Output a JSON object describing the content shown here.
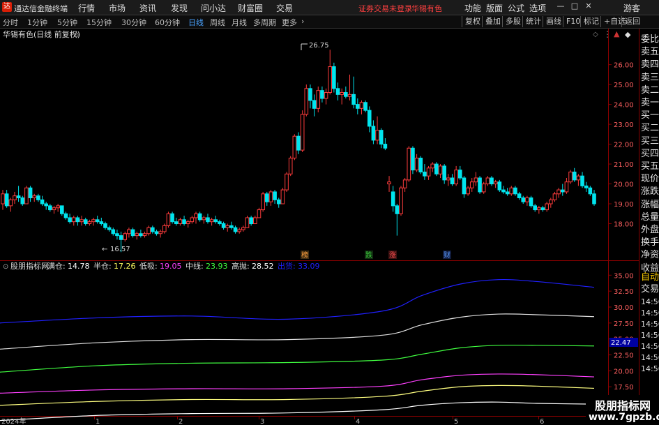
{
  "app": {
    "title": "通达信金融终端",
    "logo_text": "达"
  },
  "menu": [
    "行情",
    "市场",
    "资讯",
    "发现",
    "问小达",
    "财富圈",
    "交易"
  ],
  "warning": {
    "status": "证券交易未登录",
    "stock": "华锡有色"
  },
  "top_right": [
    "功能",
    "版面",
    "公式",
    "选项"
  ],
  "window_buttons": {
    "min": "—",
    "max": "□",
    "close": "✕",
    "guest": "游客"
  },
  "periods": [
    "分时",
    "1分钟",
    "5分钟",
    "15分钟",
    "30分钟",
    "60分钟",
    "日线",
    "周线",
    "月线",
    "多周期",
    "更多"
  ],
  "active_period": "日线",
  "toolbar_right": [
    "复权",
    "叠加",
    "多股",
    "统计",
    "画线",
    "F10",
    "标记",
    "+自选",
    "返回"
  ],
  "main_chart": {
    "title": "华锡有色(日线 前复权)",
    "max_label": "26.75",
    "min_label": "16.57"
  },
  "signals": [
    {
      "text": "榜",
      "color": "#ffa040"
    },
    {
      "text": "跌",
      "color": "#3dd13d"
    },
    {
      "text": "涨",
      "color": "#ff5050"
    },
    {
      "text": "财",
      "color": "#5a9bff"
    }
  ],
  "indicator": {
    "name": "股朋指标网",
    "items": [
      {
        "label": "满仓:",
        "value": "14.78",
        "color": "#ffffff"
      },
      {
        "label": "半仓:",
        "value": "17.26",
        "color": "#ffff60"
      },
      {
        "label": "低吸:",
        "value": "19.05",
        "color": "#ff40ff"
      },
      {
        "label": "中线:",
        "value": "23.93",
        "color": "#40ff40"
      },
      {
        "label": "高抛:",
        "value": "28.52",
        "color": "#ffffff"
      },
      {
        "label": "出货:",
        "value": "33.09",
        "color": "#2020ff"
      }
    ],
    "current": "22.47"
  },
  "right_panel": {
    "quote": [
      "委比",
      "卖五",
      "卖四",
      "卖三",
      "卖二",
      "卖一",
      "买一",
      "买二",
      "买三",
      "买四",
      "买五",
      "现价",
      "涨跌",
      "涨幅",
      "总量",
      "外盘",
      "换手",
      "净资",
      "收益"
    ],
    "lower": [
      "自动",
      "交易"
    ],
    "times": [
      "14:56",
      "14:56",
      "14:56",
      "14:56",
      "14:56",
      "14:56",
      "14:56"
    ]
  },
  "x_axis": [
    "2024年",
    "1",
    "2",
    "3",
    "4",
    "5",
    "6"
  ],
  "watermark": {
    "line1": "股朋指标网",
    "line2": "www.7gpzb.com"
  },
  "chart_data": [
    {
      "type": "candlestick",
      "title": "华锡有色(日线 前复权)",
      "ylim": [
        17.0,
        26.9
      ],
      "yticks": [
        18,
        19,
        20,
        21,
        22,
        23,
        24,
        25,
        26
      ],
      "ohlc": [
        [
          19.0,
          19.7,
          18.7,
          19.5
        ],
        [
          19.5,
          19.7,
          18.8,
          18.9
        ],
        [
          18.9,
          19.3,
          18.6,
          19.2
        ],
        [
          19.2,
          19.6,
          19.0,
          19.4
        ],
        [
          19.4,
          19.9,
          19.1,
          19.3
        ],
        [
          19.3,
          19.4,
          18.9,
          19.0
        ],
        [
          19.0,
          19.9,
          19.0,
          19.8
        ],
        [
          19.8,
          19.9,
          19.1,
          19.3
        ],
        [
          19.3,
          19.5,
          19.1,
          19.4
        ],
        [
          19.4,
          19.5,
          19.1,
          19.2
        ],
        [
          19.2,
          19.4,
          18.9,
          19.0
        ],
        [
          19.0,
          19.1,
          18.7,
          18.9
        ],
        [
          18.9,
          19.0,
          18.6,
          18.7
        ],
        [
          18.7,
          18.9,
          18.5,
          18.8
        ],
        [
          18.8,
          19.0,
          18.6,
          18.9
        ],
        [
          18.9,
          18.9,
          18.4,
          18.5
        ],
        [
          18.5,
          18.6,
          18.2,
          18.3
        ],
        [
          18.3,
          18.5,
          18.0,
          18.1
        ],
        [
          18.1,
          18.4,
          17.9,
          18.3
        ],
        [
          18.3,
          18.4,
          17.9,
          18.1
        ],
        [
          18.1,
          18.4,
          17.9,
          18.2
        ],
        [
          18.2,
          18.3,
          17.9,
          18.0
        ],
        [
          18.0,
          18.2,
          17.9,
          18.1
        ],
        [
          18.1,
          18.3,
          17.9,
          18.2
        ],
        [
          18.2,
          18.4,
          18.0,
          18.1
        ],
        [
          18.1,
          18.3,
          17.9,
          18.0
        ],
        [
          18.0,
          18.1,
          17.7,
          17.8
        ],
        [
          17.8,
          17.9,
          17.6,
          17.7
        ],
        [
          17.7,
          17.8,
          17.4,
          17.5
        ],
        [
          17.5,
          17.7,
          17.2,
          17.4
        ],
        [
          17.4,
          17.6,
          16.57,
          17.2
        ],
        [
          17.2,
          17.6,
          17.1,
          17.5
        ],
        [
          17.5,
          17.8,
          17.3,
          17.7
        ],
        [
          17.7,
          17.8,
          17.3,
          17.4
        ],
        [
          17.4,
          17.6,
          17.2,
          17.5
        ],
        [
          17.5,
          17.7,
          17.3,
          17.4
        ],
        [
          17.4,
          17.6,
          17.3,
          17.5
        ],
        [
          17.5,
          17.9,
          17.4,
          17.8
        ],
        [
          17.8,
          17.9,
          17.5,
          17.6
        ],
        [
          17.6,
          17.7,
          17.4,
          17.5
        ],
        [
          17.5,
          17.7,
          17.3,
          17.6
        ],
        [
          17.6,
          18.0,
          17.5,
          17.9
        ],
        [
          17.9,
          18.6,
          17.8,
          18.5
        ],
        [
          18.5,
          18.6,
          18.0,
          18.1
        ],
        [
          18.1,
          18.3,
          17.9,
          18.0
        ],
        [
          18.0,
          18.3,
          17.9,
          18.2
        ],
        [
          18.2,
          18.4,
          17.9,
          18.0
        ],
        [
          18.0,
          18.2,
          17.8,
          18.1
        ],
        [
          18.1,
          18.4,
          18.0,
          18.3
        ],
        [
          18.3,
          18.6,
          18.0,
          18.5
        ],
        [
          18.5,
          18.6,
          18.1,
          18.2
        ],
        [
          18.2,
          18.4,
          18.0,
          18.3
        ],
        [
          18.3,
          18.5,
          18.0,
          18.1
        ],
        [
          18.1,
          18.3,
          17.9,
          18.2
        ],
        [
          18.2,
          18.4,
          18.0,
          18.1
        ],
        [
          18.1,
          18.2,
          17.9,
          18.0
        ],
        [
          18.0,
          18.1,
          17.7,
          17.8
        ],
        [
          17.8,
          18.0,
          17.6,
          17.9
        ],
        [
          17.9,
          18.1,
          17.7,
          17.8
        ],
        [
          17.8,
          17.9,
          17.5,
          17.6
        ],
        [
          17.6,
          17.8,
          17.5,
          17.7
        ],
        [
          17.7,
          17.9,
          17.6,
          17.8
        ],
        [
          17.8,
          18.4,
          17.8,
          18.3
        ],
        [
          18.3,
          18.4,
          17.9,
          18.0
        ],
        [
          18.0,
          18.4,
          18.0,
          18.3
        ],
        [
          18.3,
          18.8,
          18.3,
          18.7
        ],
        [
          18.7,
          19.6,
          18.6,
          19.5
        ],
        [
          19.5,
          19.6,
          18.9,
          19.1
        ],
        [
          19.1,
          19.7,
          18.9,
          19.6
        ],
        [
          19.6,
          19.7,
          19.0,
          19.2
        ],
        [
          19.2,
          19.3,
          18.8,
          19.0
        ],
        [
          19.0,
          19.8,
          19.0,
          19.7
        ],
        [
          19.7,
          20.6,
          19.6,
          20.5
        ],
        [
          20.5,
          21.4,
          20.4,
          21.3
        ],
        [
          21.3,
          22.5,
          21.2,
          22.4
        ],
        [
          22.4,
          22.6,
          21.5,
          21.7
        ],
        [
          21.7,
          23.7,
          21.6,
          23.5
        ],
        [
          23.5,
          25.0,
          23.4,
          24.8
        ],
        [
          24.8,
          25.0,
          23.8,
          24.2
        ],
        [
          24.2,
          24.5,
          23.4,
          23.8
        ],
        [
          23.8,
          24.9,
          23.6,
          24.7
        ],
        [
          24.7,
          24.9,
          24.1,
          24.3
        ],
        [
          24.3,
          24.8,
          24.0,
          24.6
        ],
        [
          24.6,
          26.75,
          24.5,
          25.9
        ],
        [
          25.9,
          26.1,
          24.6,
          24.8
        ],
        [
          24.8,
          25.1,
          24.2,
          24.5
        ],
        [
          24.5,
          24.8,
          24.0,
          24.6
        ],
        [
          24.6,
          24.9,
          24.3,
          24.4
        ],
        [
          24.4,
          25.5,
          24.2,
          24.5
        ],
        [
          24.5,
          25.4,
          23.8,
          24.0
        ],
        [
          24.0,
          24.3,
          23.5,
          23.8
        ],
        [
          23.8,
          24.2,
          23.5,
          24.1
        ],
        [
          24.1,
          24.2,
          23.6,
          23.7
        ],
        [
          23.7,
          23.9,
          22.6,
          22.9
        ],
        [
          22.9,
          23.2,
          22.0,
          22.2
        ],
        [
          22.2,
          23.4,
          22.0,
          22.7
        ],
        [
          22.7,
          22.8,
          21.8,
          22.0
        ],
        [
          22.0,
          22.3,
          21.7,
          21.8
        ],
        [
          20.0,
          20.4,
          19.6,
          20.1
        ],
        [
          19.6,
          19.9,
          18.6,
          18.9
        ],
        [
          18.9,
          19.0,
          17.4,
          18.5
        ],
        [
          18.5,
          19.9,
          18.4,
          19.8
        ],
        [
          19.8,
          20.3,
          19.6,
          20.2
        ],
        [
          20.2,
          21.9,
          20.1,
          21.8
        ],
        [
          21.8,
          21.9,
          20.5,
          20.7
        ],
        [
          20.7,
          21.5,
          20.6,
          21.3
        ],
        [
          21.3,
          21.4,
          20.5,
          20.6
        ],
        [
          20.6,
          21.0,
          20.2,
          20.4
        ],
        [
          20.4,
          20.9,
          20.2,
          20.8
        ],
        [
          20.8,
          21.1,
          20.6,
          21.0
        ],
        [
          21.0,
          21.1,
          20.4,
          20.5
        ],
        [
          20.5,
          21.0,
          20.3,
          20.9
        ],
        [
          20.9,
          21.0,
          20.0,
          20.2
        ],
        [
          20.2,
          20.5,
          19.9,
          20.3
        ],
        [
          20.3,
          20.5,
          19.9,
          20.0
        ],
        [
          20.0,
          20.9,
          19.9,
          20.7
        ],
        [
          20.7,
          20.9,
          20.2,
          20.3
        ],
        [
          20.3,
          20.4,
          19.3,
          19.5
        ],
        [
          19.5,
          19.9,
          19.4,
          19.8
        ],
        [
          19.8,
          20.3,
          19.6,
          20.1
        ],
        [
          20.1,
          20.6,
          19.9,
          20.3
        ],
        [
          20.3,
          20.4,
          19.5,
          19.6
        ],
        [
          19.6,
          20.1,
          19.5,
          20.0
        ],
        [
          20.0,
          20.4,
          19.9,
          20.3
        ],
        [
          20.3,
          20.4,
          19.9,
          20.0
        ],
        [
          20.0,
          20.2,
          19.8,
          20.1
        ],
        [
          20.1,
          20.2,
          19.6,
          19.7
        ],
        [
          19.7,
          19.9,
          19.5,
          19.6
        ],
        [
          19.6,
          19.8,
          19.4,
          19.5
        ],
        [
          19.5,
          19.9,
          19.4,
          19.8
        ],
        [
          19.8,
          19.9,
          19.4,
          19.5
        ],
        [
          19.5,
          19.6,
          19.2,
          19.3
        ],
        [
          19.3,
          19.4,
          19.0,
          19.1
        ],
        [
          19.1,
          19.4,
          18.9,
          19.3
        ],
        [
          19.3,
          19.4,
          18.8,
          18.9
        ],
        [
          18.9,
          19.0,
          18.6,
          18.7
        ],
        [
          18.7,
          18.9,
          18.5,
          18.8
        ],
        [
          18.8,
          18.9,
          18.6,
          18.7
        ],
        [
          18.7,
          19.1,
          18.6,
          19.0
        ],
        [
          19.0,
          19.3,
          18.8,
          19.2
        ],
        [
          19.2,
          19.6,
          19.1,
          19.5
        ],
        [
          19.5,
          19.8,
          19.3,
          19.7
        ],
        [
          19.7,
          20.0,
          19.4,
          19.6
        ],
        [
          19.6,
          20.3,
          19.5,
          20.1
        ],
        [
          20.1,
          20.7,
          20.0,
          20.6
        ],
        [
          20.6,
          20.8,
          20.1,
          20.2
        ],
        [
          20.2,
          20.5,
          19.9,
          20.4
        ],
        [
          20.4,
          20.6,
          19.8,
          19.9
        ],
        [
          19.9,
          20.1,
          19.6,
          19.8
        ],
        [
          19.8,
          19.9,
          19.4,
          19.5
        ],
        [
          19.5,
          19.7,
          18.9,
          19.0
        ]
      ]
    },
    {
      "type": "line",
      "title": "股朋指标网",
      "ylim": [
        14.9,
        35.8
      ],
      "yticks": [
        15.0,
        17.5,
        20.0,
        22.5,
        25.0,
        27.5,
        30.0,
        32.5,
        35.0
      ],
      "x": [
        0,
        25,
        50,
        75,
        100,
        110,
        120,
        130,
        140,
        155
      ],
      "series": [
        {
          "name": "出货",
          "color": "#2020ff",
          "values": [
            27.5,
            28.3,
            28.6,
            28.1,
            29.4,
            31.8,
            33.6,
            34.3,
            34.0,
            33.1
          ]
        },
        {
          "name": "高抛",
          "color": "#e0e0e0",
          "values": [
            23.4,
            24.4,
            24.9,
            24.9,
            25.6,
            27.2,
            28.4,
            28.9,
            28.8,
            28.5
          ]
        },
        {
          "name": "中线",
          "color": "#40ff40",
          "values": [
            19.8,
            20.8,
            21.2,
            21.3,
            21.7,
            22.6,
            23.6,
            24.0,
            24.0,
            23.9
          ]
        },
        {
          "name": "低吸",
          "color": "#ff40ff",
          "values": [
            16.5,
            17.0,
            17.2,
            17.2,
            17.6,
            18.6,
            19.3,
            19.5,
            19.4,
            19.05
          ]
        },
        {
          "name": "半仓",
          "color": "#ffff80",
          "values": [
            14.6,
            15.2,
            15.5,
            15.5,
            16.0,
            16.8,
            17.5,
            17.7,
            17.6,
            17.26
          ]
        },
        {
          "name": "满仓",
          "color": "#ffffff",
          "values": [
            12.2,
            13.0,
            13.3,
            13.4,
            13.9,
            14.6,
            15.0,
            15.1,
            14.9,
            14.78
          ]
        }
      ]
    }
  ]
}
